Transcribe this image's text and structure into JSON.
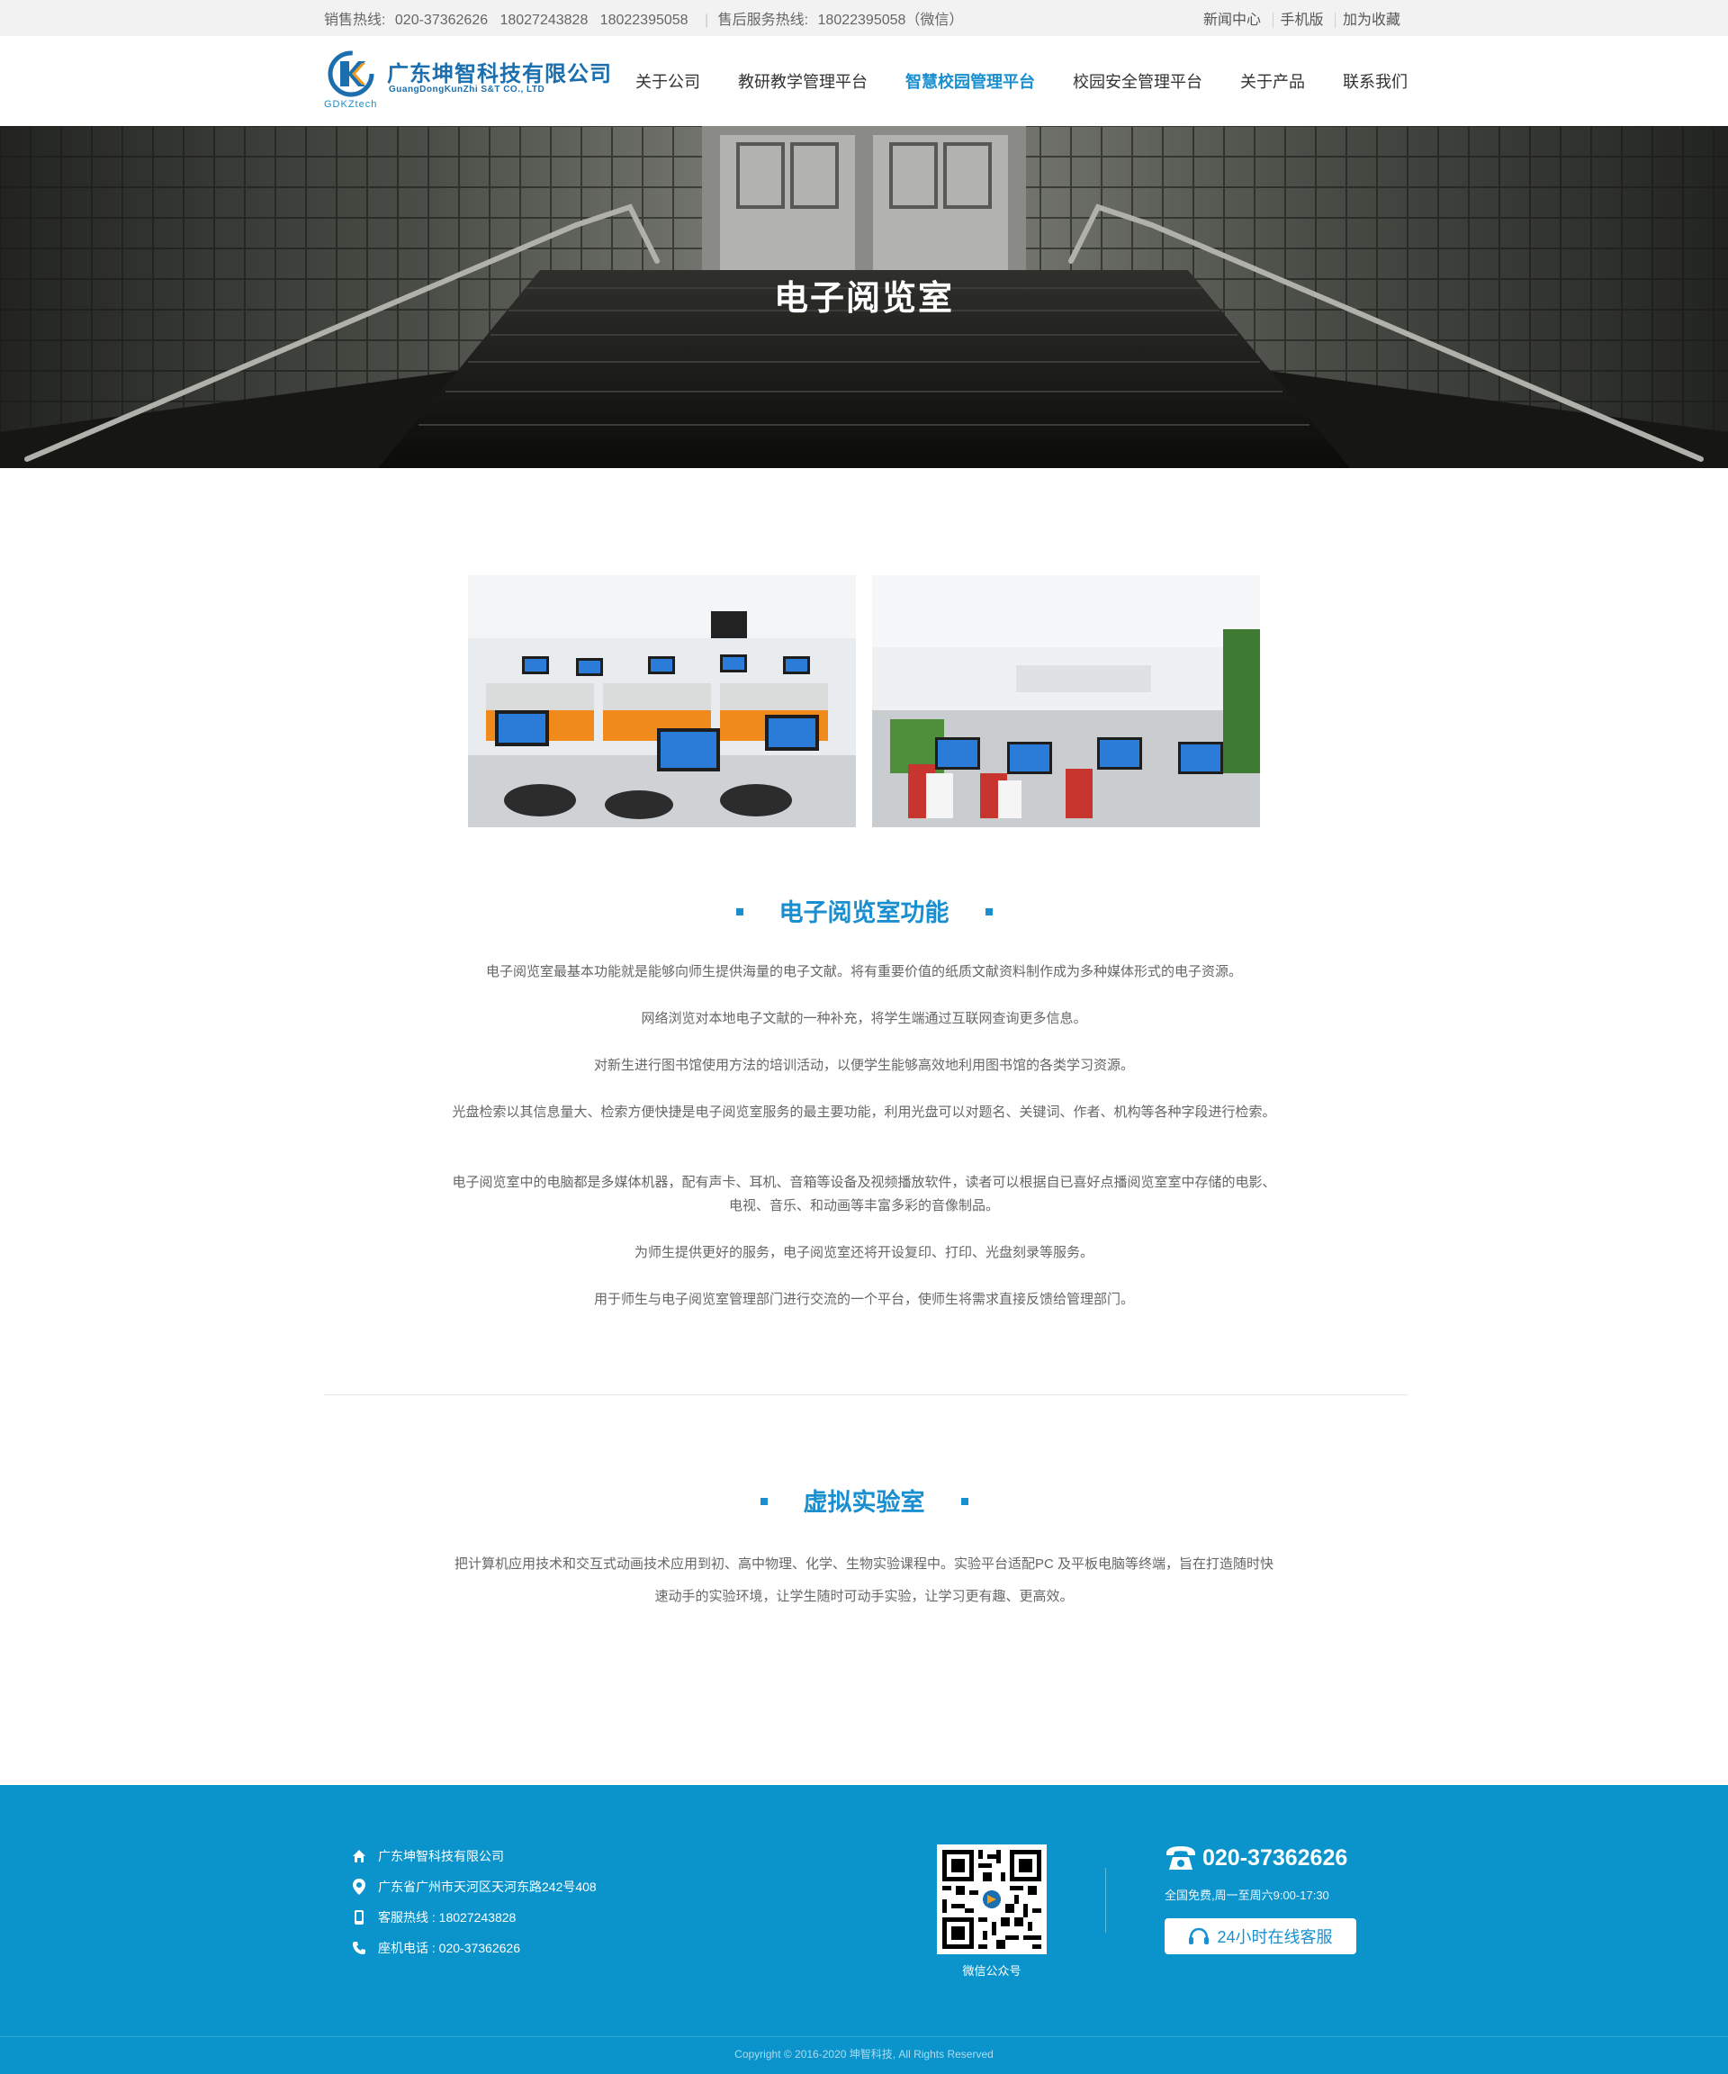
{
  "topbar": {
    "sales_label": "销售热线:",
    "sales_numbers": "020-37362626   18027243828   18022395058",
    "service_label": "售后服务热线:",
    "service_number": "18022395058（微信）",
    "links": [
      "新闻中心",
      "手机版",
      "加为收藏"
    ]
  },
  "header": {
    "logo_cn": "广东坤智科技有限公司",
    "logo_en": "GuangDongKunZhi S&T CO., LTD",
    "logo_tag": "GDKZtech",
    "nav": [
      "关于公司",
      "教研教学管理平台",
      "智慧校园管理平台",
      "校园安全管理平台",
      "关于产品",
      "联系我们"
    ],
    "active_nav": "智慧校园管理平台"
  },
  "banner": {
    "title": "电子阅览室"
  },
  "section1": {
    "title": "电子阅览室功能",
    "paragraphs": [
      "电子阅览室最基本功能就是能够向师生提供海量的电子文献。将有重要价值的纸质文献资料制作成为多种媒体形式的电子资源。",
      "网络浏览对本地电子文献的一种补充，将学生端通过互联网查询更多信息。",
      "对新生进行图书馆使用方法的培训活动，以便学生能够高效地利用图书馆的各类学习资源。",
      "光盘检索以其信息量大、检索方便快捷是电子阅览室服务的最主要功能，利用光盘可以对题名、关键词、作者、机构等各种字段进行检索。",
      "电子阅览室中的电脑都是多媒体机器，配有声卡、耳机、音箱等设备及视频播放软件，读者可以根据自已喜好点播阅览室室中存储的电影、电视、音乐、和动画等丰富多彩的音像制品。",
      "为师生提供更好的服务，电子阅览室还将开设复印、打印、光盘刻录等服务。",
      "用于师生与电子阅览室管理部门进行交流的一个平台，使师生将需求直接反馈给管理部门。"
    ]
  },
  "section2": {
    "title": "虚拟实验室",
    "paragraph": "把计算机应用技术和交互式动画技术应用到初、高中物理、化学、生物实验课程中。实验平台适配PC 及平板电脑等终端，旨在打造随时快速动手的实验环境，让学生随时可动手实验，让学习更有趣、更高效。"
  },
  "footer": {
    "company": "广东坤智科技有限公司",
    "address": "广东省广州市天河区天河东路242号408",
    "hotline": "客服热线 : 18027243828",
    "landline": "座机电话 : 020-37362626",
    "qr_label": "微信公众号",
    "phone": "020-37362626",
    "hours": "全国免费,周一至周六9:00-17:30",
    "online_service": "24小时在线客服",
    "copyright": "Copyright © 2016-2020 坤智科技, All Rights Reserved"
  },
  "colors": {
    "accent": "#1a8fd0",
    "footer_bg": "#0b94cc",
    "topbar_bg": "#f2f2f2"
  }
}
